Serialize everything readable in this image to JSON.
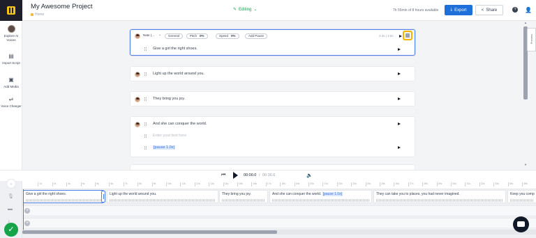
{
  "header": {
    "project_title": "My Awesome Project",
    "breadcrumb": "Home",
    "status": "Editing",
    "quota": "7h 55min of 8 hours available",
    "export_label": "Export",
    "share_label": "Share",
    "help_glyph": "?"
  },
  "sidebar": {
    "items": [
      {
        "label": "Explore AI Voices",
        "icon": "voice-avatar"
      },
      {
        "label": "Import Script",
        "icon": "document-icon"
      },
      {
        "label": "Add Media",
        "icon": "media-icon"
      },
      {
        "label": "Voice Changer",
        "icon": "voice-changer-icon"
      }
    ]
  },
  "editor": {
    "active_block": {
      "voice_name": "Nate (...",
      "style": "General",
      "pitch_label": "Pitch",
      "pitch_value": "0%",
      "speed_label": "Speed",
      "speed_value": "0%",
      "add_pause": "Add Pause",
      "duration": "3.3s | 3.6s",
      "text": "Give a girl the right shoes."
    },
    "blocks": [
      {
        "text": "Light up the world around you."
      },
      {
        "text": "They bring you joy."
      },
      {
        "text": "And she can conquer the world.",
        "placeholder": "Enter your text here",
        "pause": "[pause 1.0s]"
      }
    ],
    "preview_label": "Preview"
  },
  "player": {
    "current": "00:00.0",
    "separator": "/",
    "total": "00:36.6"
  },
  "timeline": {
    "ruler_labels": [
      "1s",
      "2s",
      "3s",
      "4s",
      "5s",
      "6s",
      "7s",
      "8s",
      "9s",
      "10s",
      "11s",
      "12s",
      "13s",
      "14s",
      "15s",
      "16s",
      "17s",
      "18s",
      "19s",
      "20s",
      "21s",
      "22s",
      "23s",
      "24s",
      "25s",
      "26s",
      "27s",
      "28s",
      "29s",
      "30s",
      "31s",
      "32s",
      "33s",
      "34s",
      "35s",
      "36s"
    ],
    "clips": [
      {
        "text": "Give a girl the right shoes."
      },
      {
        "text": "Light up the world around you."
      },
      {
        "text": "They bring you joy."
      },
      {
        "text": "And she can conquer the world.",
        "pause": "[pause 1.0s]"
      },
      {
        "text": "They can take you to places, you had never imagined."
      },
      {
        "text": "Keep you comp"
      }
    ]
  },
  "colors": {
    "accent": "#1e6fd9",
    "success": "#16a34a",
    "highlight": "#f5b400",
    "brand_dark": "#1e1f2b",
    "brand_yellow": "#f5c518"
  }
}
